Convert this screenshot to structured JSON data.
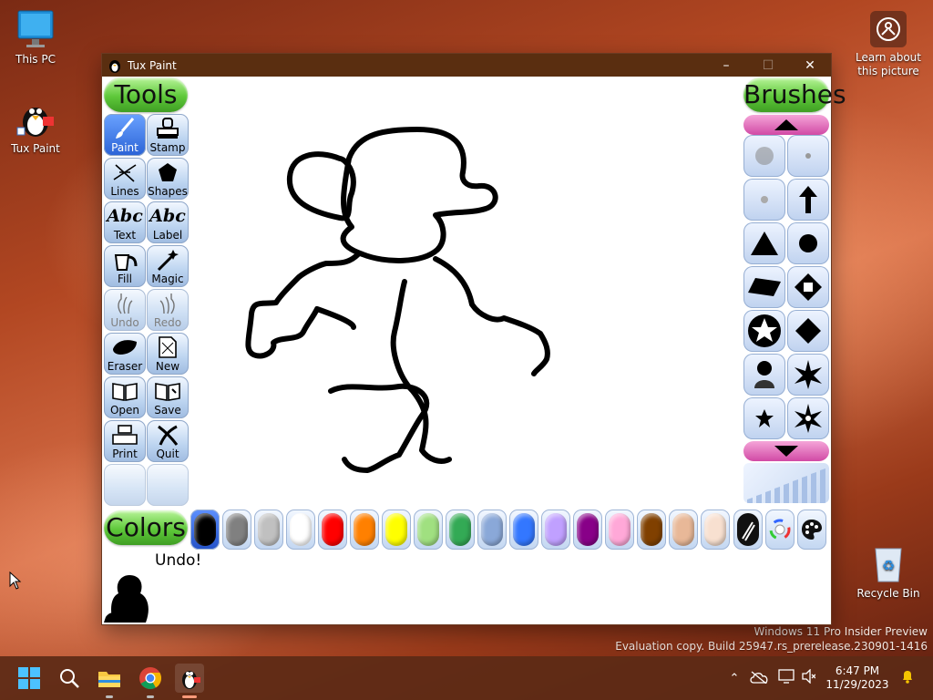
{
  "desktop": {
    "icons": [
      {
        "label": "This PC",
        "icon": "monitor-icon"
      },
      {
        "label": "Tux Paint",
        "icon": "tux-icon"
      },
      {
        "label": "Recycle Bin",
        "icon": "recycle-bin-icon"
      }
    ],
    "learn_label": "Learn about this picture",
    "watermark": {
      "line1": "Windows 11 Pro Insider Preview",
      "line2": "Evaluation copy. Build 25947.rs_prerelease.230901-1416"
    }
  },
  "window": {
    "title": "Tux Paint",
    "controls": {
      "minimize": "–",
      "maximize": "☐",
      "close": "✕"
    }
  },
  "app": {
    "tools_header": "Tools",
    "brushes_header": "Brushes",
    "colors_header": "Colors",
    "tools": [
      {
        "label": "Paint",
        "icon": "paintbrush-icon",
        "active": true
      },
      {
        "label": "Stamp",
        "icon": "stamp-icon"
      },
      {
        "label": "Lines",
        "icon": "lines-icon"
      },
      {
        "label": "Shapes",
        "icon": "pentagon-icon"
      },
      {
        "label": "Text",
        "icon": "text-icon",
        "glyph": "Abc"
      },
      {
        "label": "Label",
        "icon": "label-icon",
        "glyph": "Abc"
      },
      {
        "label": "Fill",
        "icon": "bucket-icon"
      },
      {
        "label": "Magic",
        "icon": "magic-wand-icon"
      },
      {
        "label": "Undo",
        "icon": "undo-hand-icon",
        "disabled": true
      },
      {
        "label": "Redo",
        "icon": "redo-hand-icon",
        "disabled": true
      },
      {
        "label": "Eraser",
        "icon": "eraser-icon"
      },
      {
        "label": "New",
        "icon": "new-page-icon"
      },
      {
        "label": "Open",
        "icon": "open-book-icon"
      },
      {
        "label": "Save",
        "icon": "save-book-icon"
      },
      {
        "label": "Print",
        "icon": "printer-icon"
      },
      {
        "label": "Quit",
        "icon": "quit-icon"
      }
    ],
    "colors": [
      "#000000",
      "#808080",
      "#c0c0c0",
      "#ffffff",
      "#ff0000",
      "#ff8000",
      "#ffff00",
      "#a0e080",
      "#33aa55",
      "#8aa8d8",
      "#3377ff",
      "#c0a0ff",
      "#880088",
      "#ffa8d8",
      "#804000",
      "#e8b898",
      "#f8e0d0"
    ],
    "extra_color_buttons": [
      "color-picker-icon",
      "rainbow-wheel-icon",
      "palette-icon"
    ],
    "brush_shapes": [
      "soft-dot-icon",
      "tiny-dot-icon",
      "small-dot-icon",
      "arrow-up-icon",
      "triangle-icon",
      "circle-icon",
      "parallelogram-icon",
      "diamond-square-icon",
      "star-circle-icon",
      "diamond-icon",
      "figure-stamp-icon",
      "flower-star-icon",
      "small-star-icon",
      "flower-icon"
    ],
    "status_message": "Undo!"
  },
  "taskbar": {
    "apps": [
      "start-icon",
      "search-icon",
      "file-explorer-icon",
      "chrome-icon",
      "tux-paint-icon"
    ],
    "time": "6:47 PM",
    "date": "11/29/2023"
  }
}
